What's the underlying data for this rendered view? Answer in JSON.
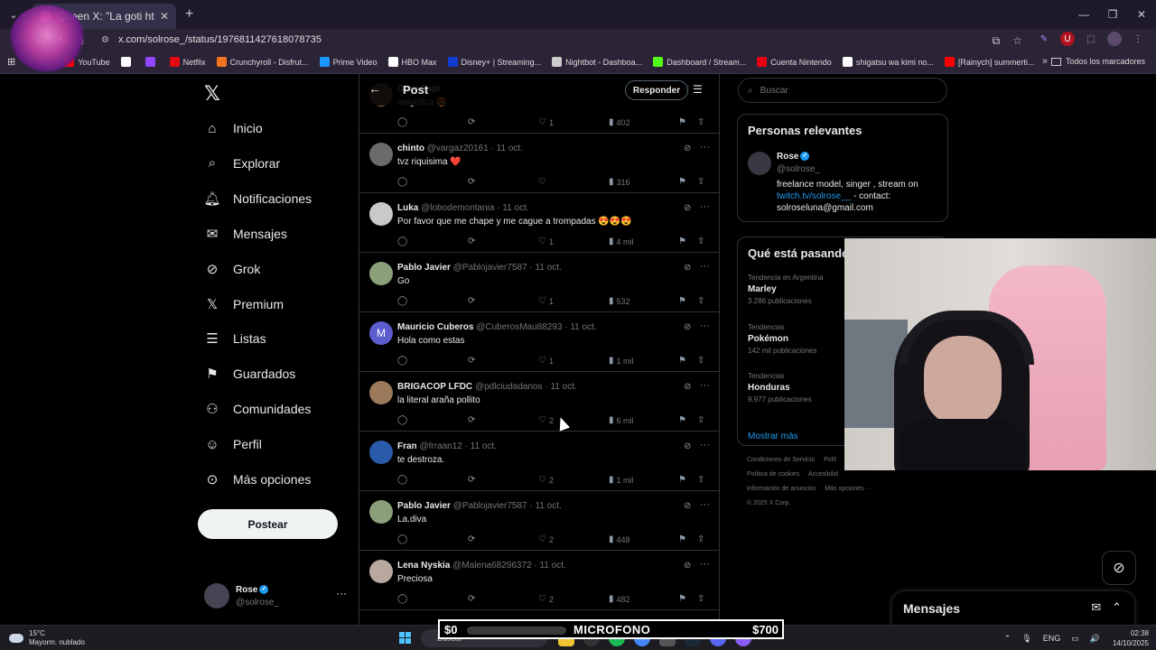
{
  "browser": {
    "tab_title": "Queen X: \"La goti https://t.co/",
    "url": "x.com/solrose_/status/1976811427618078735",
    "bookmarks": [
      {
        "label": "YouTube",
        "color": "#ff0000"
      },
      {
        "label": "",
        "color": "#ffffff"
      },
      {
        "label": "",
        "color": "#9146ff"
      },
      {
        "label": "Netflix",
        "color": "#e50914"
      },
      {
        "label": "Crunchyroll - Disfrut...",
        "color": "#f47521"
      },
      {
        "label": "Prime Video",
        "color": "#1a98ff"
      },
      {
        "label": "HBO Max",
        "color": "#ffffff"
      },
      {
        "label": "Disney+ | Streaming...",
        "color": "#113ccf"
      },
      {
        "label": "Nightbot - Dashboa...",
        "color": "#cccccc"
      },
      {
        "label": "Dashboard / Stream...",
        "color": "#53fc18"
      },
      {
        "label": "Cuenta Nintendo",
        "color": "#e60012"
      },
      {
        "label": "shigatsu wa kimi no...",
        "color": "#ffffff"
      },
      {
        "label": "[Rainych] summerti...",
        "color": "#ff0000"
      }
    ],
    "all_bookmarks": "Todos los marcadores"
  },
  "nav": {
    "items": [
      {
        "label": "Inicio",
        "icon": "home-icon"
      },
      {
        "label": "Explorar",
        "icon": "search-icon"
      },
      {
        "label": "Notificaciones",
        "icon": "bell-icon"
      },
      {
        "label": "Mensajes",
        "icon": "mail-icon"
      },
      {
        "label": "Grok",
        "icon": "grok-icon"
      },
      {
        "label": "Premium",
        "icon": "x-premium-icon"
      },
      {
        "label": "Listas",
        "icon": "list-icon"
      },
      {
        "label": "Guardados",
        "icon": "bookmark-icon"
      },
      {
        "label": "Comunidades",
        "icon": "communities-icon"
      },
      {
        "label": "Perfil",
        "icon": "profile-icon"
      },
      {
        "label": "Más opciones",
        "icon": "more-circle-icon"
      }
    ],
    "post_button": "Postear",
    "account": {
      "name": "Rose",
      "handle": "@solrose_"
    }
  },
  "main": {
    "title": "Post",
    "reply_button": "Responder",
    "tweets": [
      {
        "name": "Gran Papi",
        "handle": "",
        "date": "",
        "text": "nalgotica 😍",
        "replies": "",
        "likes": "1",
        "views": "402"
      },
      {
        "name": "chinto",
        "handle": "@vargaz20161",
        "date": "11 oct.",
        "text": "tvz riquisima ❤️",
        "replies": "",
        "likes": "",
        "views": "316"
      },
      {
        "name": "Luka",
        "handle": "@lobodemontania",
        "date": "11 oct.",
        "text": "Por favor que me chape y me cague a trompadas 😍😍😍",
        "replies": "",
        "likes": "1",
        "views": "4 mil"
      },
      {
        "name": "Pablo Javier",
        "handle": "@Pablojavier7587",
        "date": "11 oct.",
        "text": "Go",
        "replies": "",
        "likes": "1",
        "views": "532"
      },
      {
        "name": "Mauricio Cuberos",
        "handle": "@CuberosMau88293",
        "date": "11 oct.",
        "text": "Hola como estas",
        "replies": "",
        "likes": "1",
        "views": "1 mil"
      },
      {
        "name": "BRIGACOP LFDC",
        "handle": "@pdlciudadanos",
        "date": "11 oct.",
        "text": "la literal araña pollito",
        "replies": "",
        "likes": "2",
        "views": "6 mil"
      },
      {
        "name": "Fran",
        "handle": "@frraan12",
        "date": "11 oct.",
        "text": "te destroza.",
        "replies": "",
        "likes": "2",
        "views": "1 mil"
      },
      {
        "name": "Pablo Javier",
        "handle": "@Pablojavier7587",
        "date": "11 oct.",
        "text": "La.diva",
        "replies": "",
        "likes": "2",
        "views": "448"
      },
      {
        "name": "Lena Nyskia",
        "handle": "@Malena68296372",
        "date": "11 oct.",
        "text": "Preciosa",
        "replies": "",
        "likes": "2",
        "views": "482"
      }
    ]
  },
  "right": {
    "search_placeholder": "Buscar",
    "relevant_title": "Personas relevantes",
    "relevant_person": {
      "name": "Rose",
      "handle": "@solrose_",
      "bio_a": "freelance model, singer , stream on",
      "bio_link": "twitch.tv/solrose__",
      "bio_b": "- contact:",
      "bio_email": "solroseluna@gmail.com"
    },
    "trends_title": "Qué está pasando",
    "trends": [
      {
        "meta": "Tendencia en Argentina",
        "name": "Marley",
        "count": "3.286 publicaciones"
      },
      {
        "meta": "Tendencias",
        "name": "Pokémon",
        "count": "142 mil publicaciones"
      },
      {
        "meta": "Tendencias",
        "name": "Honduras",
        "count": "9.977 publicaciones"
      }
    ],
    "show_more": "Mostrar más",
    "footer": [
      "Condiciones de Servicio",
      "Polít",
      "Política de cookies",
      "Accesibilid",
      "Información de anuncios",
      "Más opciones ···",
      "© 2025 X Corp."
    ]
  },
  "messages_drawer": {
    "title": "Mensajes"
  },
  "stream_overlay": {
    "left_amount": "$0",
    "label": "MICROFONO",
    "right_amount": "$700"
  },
  "taskbar": {
    "weather_temp": "15°C",
    "weather_desc": "Mayorm. nublado",
    "search_placeholder": "Buscar",
    "lang": "ENG",
    "time": "02:38",
    "date": "14/10/2025"
  }
}
